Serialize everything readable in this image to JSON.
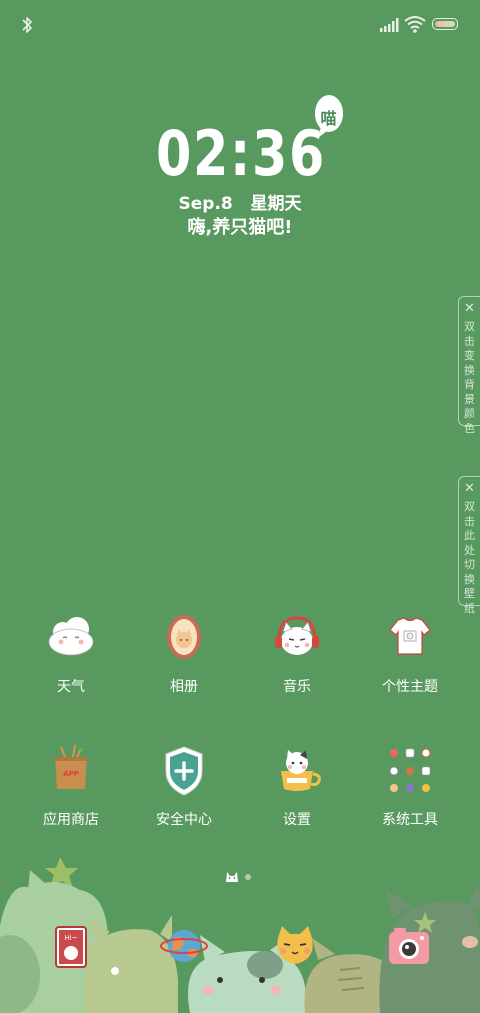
{
  "clock": {
    "time": "02:36",
    "date_line": "Sep.8   星期天",
    "tagline": "嗨,养只猫吧!",
    "bubble": "喵"
  },
  "side_tabs": [
    {
      "close": "✕",
      "text": "双击变换背景颜色"
    },
    {
      "close": "✕",
      "text": "双击此处切换壁纸"
    }
  ],
  "apps": [
    {
      "label": "天气",
      "icon": "cloud-cat-icon"
    },
    {
      "label": "相册",
      "icon": "cat-frame-icon"
    },
    {
      "label": "音乐",
      "icon": "headphone-cat-icon"
    },
    {
      "label": "个性主题",
      "icon": "tshirt-icon"
    },
    {
      "label": "应用商店",
      "icon": "shopping-bag-icon"
    },
    {
      "label": "安全中心",
      "icon": "shield-plus-icon"
    },
    {
      "label": "设置",
      "icon": "cat-mug-icon"
    },
    {
      "label": "系统工具",
      "icon": "tools-grid-icon"
    }
  ],
  "dock": [
    {
      "icon": "hi-card-icon"
    },
    {
      "icon": "globe-icon"
    },
    {
      "icon": "yellow-cat-icon"
    },
    {
      "icon": "camera-icon"
    }
  ],
  "page_bubble": "APP",
  "colors": {
    "background": "#58995f",
    "text": "#ffffff"
  }
}
